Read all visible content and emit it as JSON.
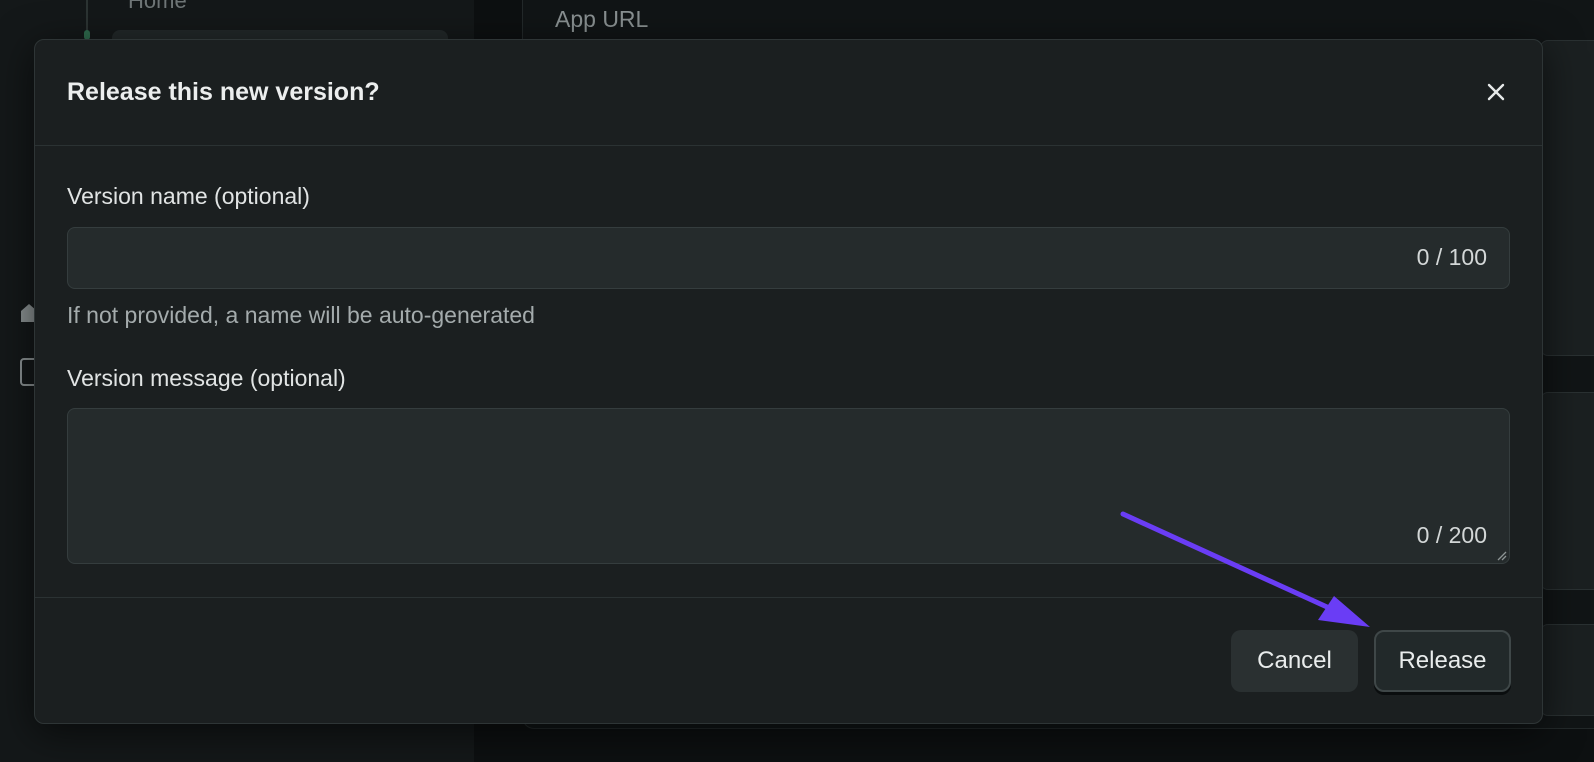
{
  "background": {
    "sidebar_item_label": "Home",
    "main_field_label": "App URL"
  },
  "modal": {
    "title": "Release this new version?",
    "close_icon": "close-icon",
    "version_name": {
      "label": "Version name (optional)",
      "value": "",
      "counter": "0 / 100",
      "helper": "If not provided, a name will be auto-generated"
    },
    "version_message": {
      "label": "Version message (optional)",
      "value": "",
      "counter": "0 / 200"
    },
    "buttons": {
      "cancel": "Cancel",
      "release": "Release"
    }
  },
  "annotation": {
    "arrow_color": "#6a3df5",
    "points_to": "release-button"
  },
  "colors": {
    "modal_bg": "#1b1f20",
    "input_bg": "#252b2c",
    "page_bg": "#0d1011"
  }
}
